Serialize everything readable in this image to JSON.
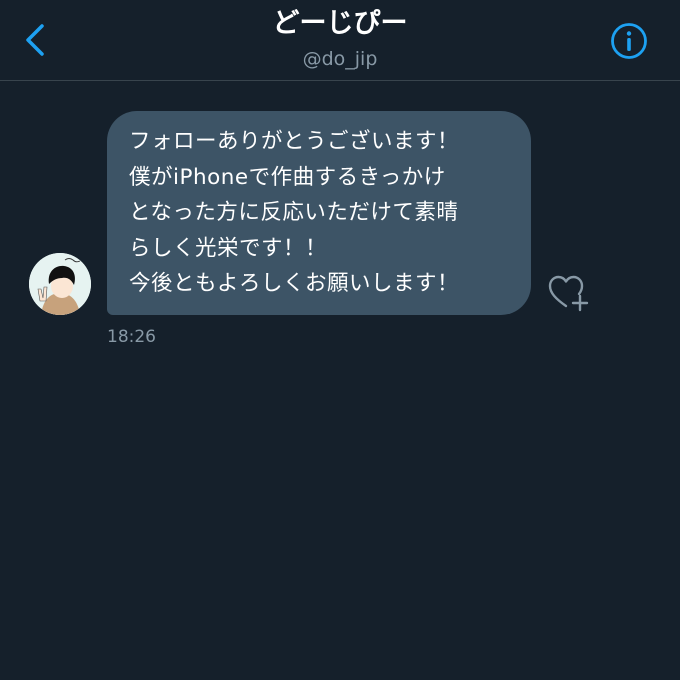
{
  "header": {
    "title": "どーじぴー",
    "handle": "@do_jip",
    "back_icon": "chevron-left-icon",
    "info_icon": "info-circle-icon",
    "accent_color": "#1da1f2"
  },
  "message": {
    "lines": [
      "フォローありがとうございます！",
      "僕がiPhoneで作曲するきっかけ",
      "となった方に反応いただけて素晴",
      "らしく光栄です！！",
      "今後ともよろしくお願いします！"
    ],
    "time": "18:26",
    "bubble_color": "#3d5466",
    "like_icon": "heart-plus-icon"
  },
  "avatar": {
    "icon": "user-avatar",
    "label": "どーじぴー"
  },
  "colors": {
    "background": "#15202b",
    "divider": "#38444d",
    "secondary_text": "#8899a6"
  }
}
